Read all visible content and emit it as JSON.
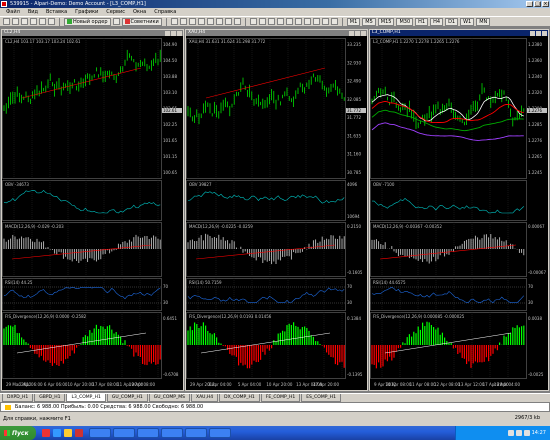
{
  "window": {
    "title": "539915 - Alpari-Demo: Demo Account - [L3_COMP,H1]"
  },
  "menu": [
    "Файл",
    "Вид",
    "Вставка",
    "Графики",
    "Сервис",
    "Окна",
    "Справка"
  ],
  "toolbar": {
    "new_order": "Новый ордер",
    "advisors": "Советники"
  },
  "charts": [
    {
      "title": "CL2,H4",
      "header": "CL2,H4  103.17 103.17 103.24 102.61",
      "price_ticks": [
        "104.90",
        "104.50",
        "103.88",
        "103.10",
        "102.65",
        "102.25",
        "101.65",
        "101.15",
        "100.65"
      ],
      "last_price": "102.61",
      "obv_label": "OBV -34673",
      "macd_label": "MACD(12,26,9) -0.029 -0.203",
      "rsi_label": "RSI(14) 44.25",
      "fis_label": "FIS_Divergence(12,26,9) 0.0000 -0.2582",
      "rsi_levels": [
        "70",
        "30"
      ],
      "fis_ticks": [
        "0.6451",
        "-0.6708"
      ],
      "dates": [
        "29 Mar 2012",
        "2 Apr 06:00",
        "6 Apr 06:00",
        "10 Apr 20:00",
        "17 Apr 08:00",
        "11 Apr 20:00",
        "19 Apr 08:00"
      ]
    },
    {
      "title": "XAU,H4",
      "header": "XAU,H4  31.631 31.624 31.298 31.772",
      "price_ticks": [
        "33.235",
        "32.930",
        "32.490",
        "32.085",
        "31.772",
        "31.635",
        "31.160",
        "30.785"
      ],
      "last_price": "31.772",
      "obv_label": "OBV 39827",
      "macd_label": "MACD(12,26,9) -0.0225 -0.0259",
      "rsi_label": "RSI(14) 50.7159",
      "fis_label": "FIS_Divergence(12,26,9) 0.0193 0.01456",
      "rsi_levels": [
        "70",
        "30"
      ],
      "obv_ticks": [
        "4096",
        "10694"
      ],
      "macd_ticks": [
        "0.2150",
        "-0.1605"
      ],
      "fis_ticks": [
        "0.1384",
        "-0.1395"
      ],
      "dates": [
        "29 Apr 2012",
        "3 Apr 04:00",
        "5 Apr 04:00",
        "10 Apr 20:00",
        "13 Apr 04:00",
        "17 Apr 20:00"
      ]
    },
    {
      "title": "L3_COMP,H1",
      "header": "L3_COMP,H1  1.2270 1.2278 1.2265 1.2276",
      "price_ticks": [
        "1.2380",
        "1.2360",
        "1.2340",
        "1.2320",
        "1.2300",
        "1.2285",
        "1.2276",
        "1.2265",
        "1.2245"
      ],
      "last_price": "1.2276",
      "obv_label": "OBV -7100",
      "macd_label": "MACD(12,26,9) -0.00367 -0.00352",
      "rsi_label": "RSI(14) 44.6575",
      "fis_label": "FIS_Divergence(12,26,9) 0.000085 -0.000025",
      "rsi_levels": [
        "70",
        "30"
      ],
      "macd_ticks": [
        "0.00067",
        "-0.00067"
      ],
      "fis_ticks": [
        "0.0038",
        "-0.0025"
      ],
      "dates": [
        "9 Apr 2012",
        "10 Apr 08:00",
        "11 Apr 08:00",
        "12 Apr 08:00",
        "13 Apr 12:00",
        "17 Apr 20:00",
        "18 Apr 04:00"
      ]
    }
  ],
  "tabs": [
    "DXPD_H1",
    "GBPD_H1",
    "L3_COMP_H1",
    "GU_COMP_H1",
    "GU_COMP_MS",
    "XAU,H4",
    "DX_COMP_H1",
    "FE_COMP_H1",
    "ES_COMP_H1"
  ],
  "active_tab_index": 2,
  "terminal": {
    "text": "Баланс: 6 988.00  Прибыль: 0.00  Средства: 6 988.00  Свободно: 6 988.00"
  },
  "status": {
    "help": "Для справки, нажмите F1",
    "traffic": "2967/3 kb"
  },
  "taskbar": {
    "start_label": "Пуск",
    "clock": "14:27"
  },
  "colors": {
    "candle": "#00ff00",
    "ma_red": "#ff0000",
    "indicator_teal": "#00c0c0",
    "macd_hist": "#c0c0c0",
    "rsi_blue": "#1e6ae0",
    "fis_green": "#00ff00",
    "fis_red": "#ff0000"
  }
}
